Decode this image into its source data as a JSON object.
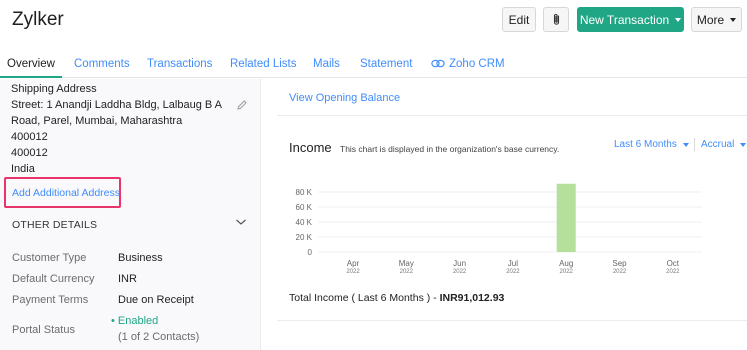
{
  "header": {
    "title": "Zylker",
    "edit_label": "Edit",
    "new_transaction_label": "New Transaction",
    "more_label": "More"
  },
  "tabs": [
    {
      "label": "Overview"
    },
    {
      "label": "Comments"
    },
    {
      "label": "Transactions"
    },
    {
      "label": "Related Lists"
    },
    {
      "label": "Mails"
    },
    {
      "label": "Statement"
    },
    {
      "label": "Zoho CRM"
    }
  ],
  "shipping": {
    "heading": "Shipping Address",
    "lines": [
      "Street: 1 Anandji Laddha Bldg, Lalbaug B A",
      "Road, Parel, Mumbai, Maharashtra",
      "400012",
      "400012",
      "India"
    ],
    "add_link": "Add Additional Address"
  },
  "other_details": {
    "heading": "OTHER DETAILS",
    "rows": [
      {
        "label": "Customer Type",
        "value": "Business"
      },
      {
        "label": "Default Currency",
        "value": "INR"
      },
      {
        "label": "Payment Terms",
        "value": "Due on Receipt"
      },
      {
        "label": "Portal Status",
        "value": "Enabled",
        "sub": "(1 of 2 Contacts)"
      }
    ]
  },
  "main": {
    "view_opening_balance": "View Opening Balance",
    "income_title": "Income",
    "income_note": "This chart is displayed in the organization's base currency.",
    "period_dropdown": "Last 6 Months",
    "basis_dropdown": "Accrual",
    "total_label": "Total Income ( Last 6 Months ) -",
    "total_value": "INR91,012.93"
  },
  "colors": {
    "accent": "#21a685",
    "link": "#408dfb",
    "highlight": "#e8336b",
    "bar": "#b5e09b"
  },
  "chart_data": {
    "type": "bar",
    "categories": [
      "Apr",
      "May",
      "Jun",
      "Jul",
      "Aug",
      "Sep",
      "Oct"
    ],
    "years": [
      "2022",
      "2022",
      "2022",
      "2022",
      "2022",
      "2022",
      "2022"
    ],
    "y_ticks": [
      "80 K",
      "60 K",
      "40 K",
      "20 K",
      "0"
    ],
    "tick_values": [
      80000,
      60000,
      40000,
      20000,
      0
    ],
    "values": [
      0,
      0,
      0,
      0,
      91012.93,
      0,
      0
    ],
    "ylim": [
      0,
      80000
    ],
    "grid": true
  }
}
